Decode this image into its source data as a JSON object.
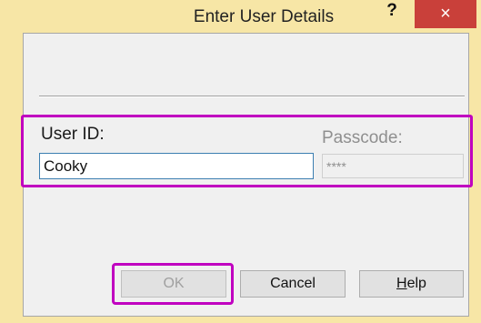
{
  "window": {
    "title": "Enter User Details",
    "help_glyph": "?",
    "close_glyph": "×"
  },
  "form": {
    "user_id_label": "User ID:",
    "user_id_value": "Cooky",
    "passcode_label": "Passcode:",
    "passcode_value": "****"
  },
  "buttons": {
    "ok_label": "OK",
    "cancel_label": "Cancel",
    "help_mnemonic": "H",
    "help_rest": "elp"
  },
  "colors": {
    "window_frame": "#f7e6a6",
    "close_button": "#c9403a",
    "highlight": "#c000c0",
    "input_focus_border": "#3c7fb1"
  }
}
